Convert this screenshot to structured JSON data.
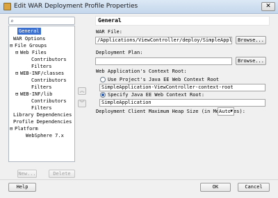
{
  "window": {
    "title": "Edit WAR Deployment Profile Properties",
    "close_label": "✕"
  },
  "search": {
    "icon": "binoculars-icon",
    "glyph": "⌕",
    "value": ""
  },
  "tree": {
    "items": [
      {
        "label": "General",
        "expander": ""
      },
      {
        "label": "WAR Options",
        "expander": ""
      },
      {
        "label": "File Groups",
        "expander": "⊟"
      },
      {
        "label": "Web Files",
        "expander": "⊟"
      },
      {
        "label": "Contributors",
        "expander": ""
      },
      {
        "label": "Filters",
        "expander": ""
      },
      {
        "label": "WEB-INF/classes",
        "expander": "⊟"
      },
      {
        "label": "Contributors",
        "expander": ""
      },
      {
        "label": "Filters",
        "expander": ""
      },
      {
        "label": "WEB-INF/lib",
        "expander": "⊟"
      },
      {
        "label": "Contributors",
        "expander": ""
      },
      {
        "label": "Filters",
        "expander": ""
      },
      {
        "label": "Library Dependencies",
        "expander": ""
      },
      {
        "label": "Profile Dependencies",
        "expander": ""
      },
      {
        "label": "Platform",
        "expander": "⊟"
      },
      {
        "label": "WebSphere 7.x",
        "expander": ""
      }
    ],
    "new_label": "New...",
    "delete_label": "Delete"
  },
  "move": {
    "up_glyph": "︽",
    "down_glyph": "︾"
  },
  "panel": {
    "title": "General",
    "war_file_label": "WAR File:",
    "war_file_value": "/Applications/ViewController/deploy/SimpleApplication.war",
    "deployment_plan_label": "Deployment Plan:",
    "deployment_plan_value": "",
    "browse_label": "Browse...",
    "context_root_label": "Web Application's Context Root:",
    "radio_project_label": "Use Project's Java EE Web Context Root",
    "project_root_value": "SimpleApplication-ViewController-context-root",
    "radio_specify_label": "Specify Java EE Web Context Root:",
    "specify_root_value": "SimpleApplication",
    "heap_label": "Deployment Client Maximum Heap Size (in Megabytes):",
    "heap_value": "Auto",
    "heap_caret": "▼"
  },
  "footer": {
    "help_label": "Help",
    "ok_label": "OK",
    "cancel_label": "Cancel"
  }
}
